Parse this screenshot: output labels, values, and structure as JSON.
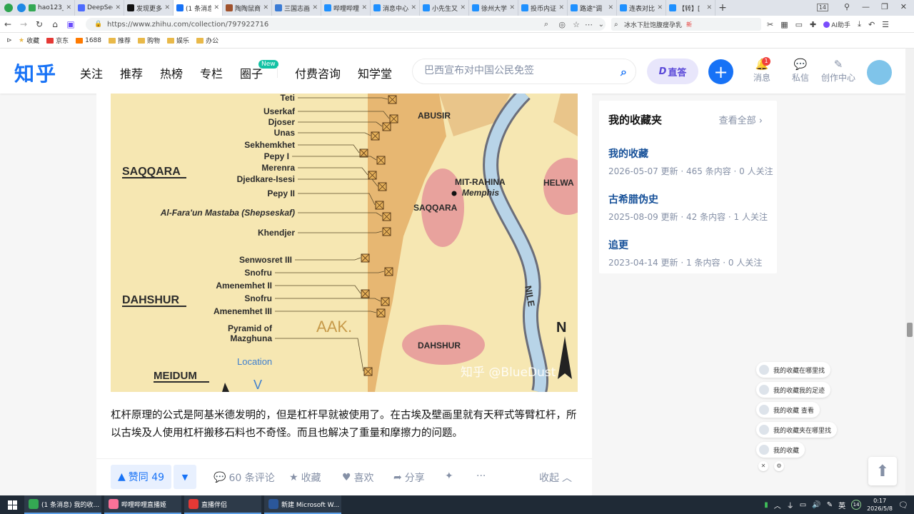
{
  "browser": {
    "tabs": [
      {
        "label": "hao123_",
        "color": "#34a853",
        "active": false
      },
      {
        "label": "DeepSee",
        "color": "#4d6bfe",
        "active": false
      },
      {
        "label": "发现更多",
        "color": "#111111",
        "active": false
      },
      {
        "label": "(1 条消息",
        "color": "#1772f6",
        "active": true
      },
      {
        "label": "陶陶鼠商",
        "color": "#a0522d",
        "active": false
      },
      {
        "label": "三国志画",
        "color": "#3a7bd5",
        "active": false
      },
      {
        "label": "哔哩哔哩",
        "color": "#1e90ff",
        "active": false
      },
      {
        "label": "消息中心",
        "color": "#1e90ff",
        "active": false
      },
      {
        "label": "小先生又",
        "color": "#1e90ff",
        "active": false
      },
      {
        "label": "徐州大学",
        "color": "#1e90ff",
        "active": false
      },
      {
        "label": "投币内证",
        "color": "#1e90ff",
        "active": false
      },
      {
        "label": "路途\"调",
        "color": "#1e90ff",
        "active": false
      },
      {
        "label": "连表对比",
        "color": "#1e90ff",
        "active": false
      },
      {
        "label": "【转】[",
        "color": "#1e90ff",
        "active": false
      }
    ],
    "tab_count_badge": "14",
    "url": "https://www.zhihu.com/collection/797922716",
    "search_text": "冰水下肚饱腹瘦孕乳",
    "search_badge": "新",
    "ai_label": "AI助手",
    "bookmarks": [
      "收藏",
      "京东",
      "1688",
      "推荐",
      "购物",
      "娱乐",
      "办公"
    ]
  },
  "zhihu": {
    "logo": "知乎",
    "nav": [
      "关注",
      "推荐",
      "热榜",
      "专栏",
      "圈子",
      "付费咨询",
      "知学堂"
    ],
    "new_badge": "New",
    "search_placeholder": "巴西宣布对中国公民免签",
    "zhida_label": "直答",
    "header_items": [
      {
        "label": "消息",
        "badge": "1"
      },
      {
        "label": "私信"
      },
      {
        "label": "创作中心"
      }
    ]
  },
  "map": {
    "left_labels": [
      "Teti",
      "Userkaf",
      "Djoser",
      "Unas",
      "Sekhemkhet",
      "Pepy I",
      "Merenra",
      "Djedkare-Isesi",
      "Pepy II",
      "Al-Fara'un Mastaba (Shepseskaf)",
      "Khendjer",
      "Senwosret III",
      "Snofru",
      "Amenemhet II",
      "Snofru",
      "Amenemhet III",
      "Pyramid of",
      "Mazghuna"
    ],
    "regions": [
      "SAQQARA",
      "DAHSHUR",
      "MEIDUM"
    ],
    "right_labels": [
      "ABUSIR",
      "MIT-RAHINA",
      "Memphis",
      "SAQQARA",
      "HELWA",
      "DAHSHUR",
      "AAK.",
      "Location",
      "N",
      "NILE"
    ],
    "watermark": "知乎 @BlueDust"
  },
  "article": {
    "paragraph": "杠杆原理的公式是阿基米德发明的，但是杠杆早就被使用了。在古埃及壁画里就有天秤式等臂杠杆，所以古埃及人使用杠杆搬移石料也不奇怪。而且也解决了重量和摩擦力的问题。"
  },
  "actions": {
    "vote": "赞同 49",
    "comments": "60 条评论",
    "collect": "收藏",
    "like": "喜欢",
    "share": "分享",
    "more": "···",
    "collapse": "收起"
  },
  "sidebar": {
    "title": "我的收藏夹",
    "view_all": "查看全部",
    "collections": [
      {
        "name": "我的收藏",
        "meta": "2026-05-07 更新 · 465 条内容 · 0 人关注"
      },
      {
        "name": "古希腊伪史",
        "meta": "2025-08-09 更新 · 42 条内容 · 1 人关注"
      },
      {
        "name": "追更",
        "meta": "2023-04-14 更新 · 1 条内容 · 0 人关注"
      }
    ]
  },
  "float_chips": [
    "我的收藏在哪里找",
    "我的收藏我的足迹",
    "我的收藏 查看",
    "我的收藏夹在哪里找",
    "我的收藏"
  ],
  "taskbar": {
    "items": [
      {
        "label": "(1 条消息) 我的收...",
        "color": "#34a853"
      },
      {
        "label": "哔哩哔哩直播姬",
        "color": "#fb7299"
      },
      {
        "label": "直播伴侣",
        "color": "#e53935"
      },
      {
        "label": "新建 Microsoft W...",
        "color": "#2b579a"
      }
    ],
    "ime": "英",
    "badge": "14",
    "time": "0:17",
    "date": "2026/5/8"
  }
}
